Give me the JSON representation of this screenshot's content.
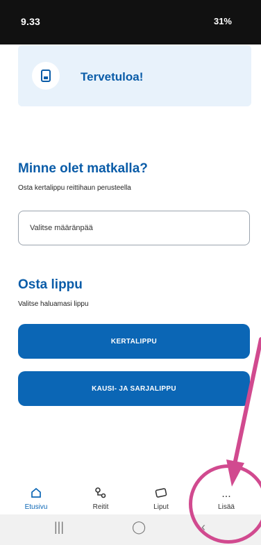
{
  "status": {
    "time": "9.33",
    "right": "31%"
  },
  "welcome": {
    "title": "Tervetuloa!"
  },
  "destination": {
    "heading": "Minne olet matkalla?",
    "subtitle": "Osta kertalippu reittihaun perusteella",
    "input_placeholder": "Valitse määränpää"
  },
  "buy": {
    "heading": "Osta lippu",
    "subtitle": "Valitse haluamasi lippu",
    "buttons": [
      "KERTALIPPU",
      "KAUSI- JA SARJALIPPU"
    ]
  },
  "nav": {
    "items": [
      "Etusivu",
      "Reitit",
      "Liput",
      "Lisää"
    ],
    "more_glyph": "..."
  },
  "annotation": {
    "color": "#d14a8f"
  }
}
